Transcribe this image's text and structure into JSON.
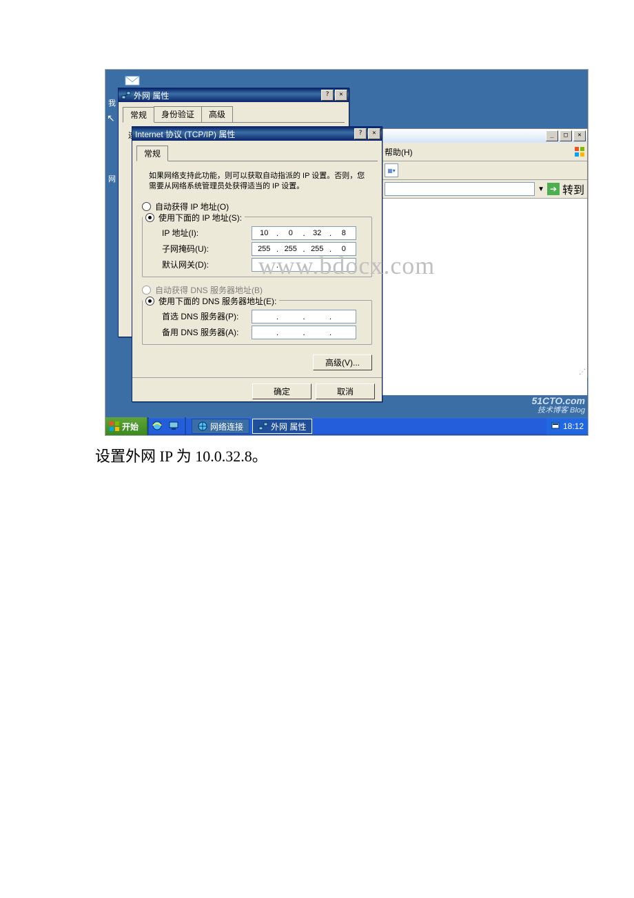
{
  "parent_dialog": {
    "title": "外网 属性",
    "tabs": [
      "常规",
      "身份验证",
      "高级"
    ],
    "subtitle": "连接时使用:"
  },
  "tcpip": {
    "title": "Internet 协议 (TCP/IP) 属性",
    "tab": "常规",
    "note": "如果网络支持此功能，则可以获取自动指派的 IP 设置。否则，您需要从网络系统管理员处获得适当的 IP 设置。",
    "radio_ip_auto": "自动获得 IP 地址(O)",
    "radio_ip_manual": "使用下面的 IP 地址(S):",
    "label_ip": "IP 地址(I):",
    "label_mask": "子网掩码(U):",
    "label_gateway": "默认网关(D):",
    "ip": [
      "10",
      "0",
      "32",
      "8"
    ],
    "mask": [
      "255",
      "255",
      "255",
      "0"
    ],
    "gateway": [
      "",
      "",
      "",
      ""
    ],
    "radio_dns_auto": "自动获得 DNS 服务器地址(B)",
    "radio_dns_manual": "使用下面的 DNS 服务器地址(E):",
    "label_dns1": "首选 DNS 服务器(P):",
    "label_dns2": "备用 DNS 服务器(A):",
    "dns1": [
      "",
      "",
      "",
      ""
    ],
    "dns2": [
      "",
      "",
      "",
      ""
    ],
    "btn_advanced": "高级(V)...",
    "btn_ok": "确定",
    "btn_cancel": "取消"
  },
  "explorer": {
    "help_menu": "帮助(H)",
    "go": "转到"
  },
  "taskbar": {
    "start": "开始",
    "task_net": "网络连接",
    "task_prop": "外网 属性",
    "time": "18:12"
  },
  "desktop": {
    "left_char1": "我",
    "left_char2": "网"
  },
  "watermark": "www.bdocx.com",
  "brand": {
    "line1": "51CTO.com",
    "line2": "技术博客  Blog"
  },
  "caption": "设置外网 IP 为 10.0.32.8。"
}
